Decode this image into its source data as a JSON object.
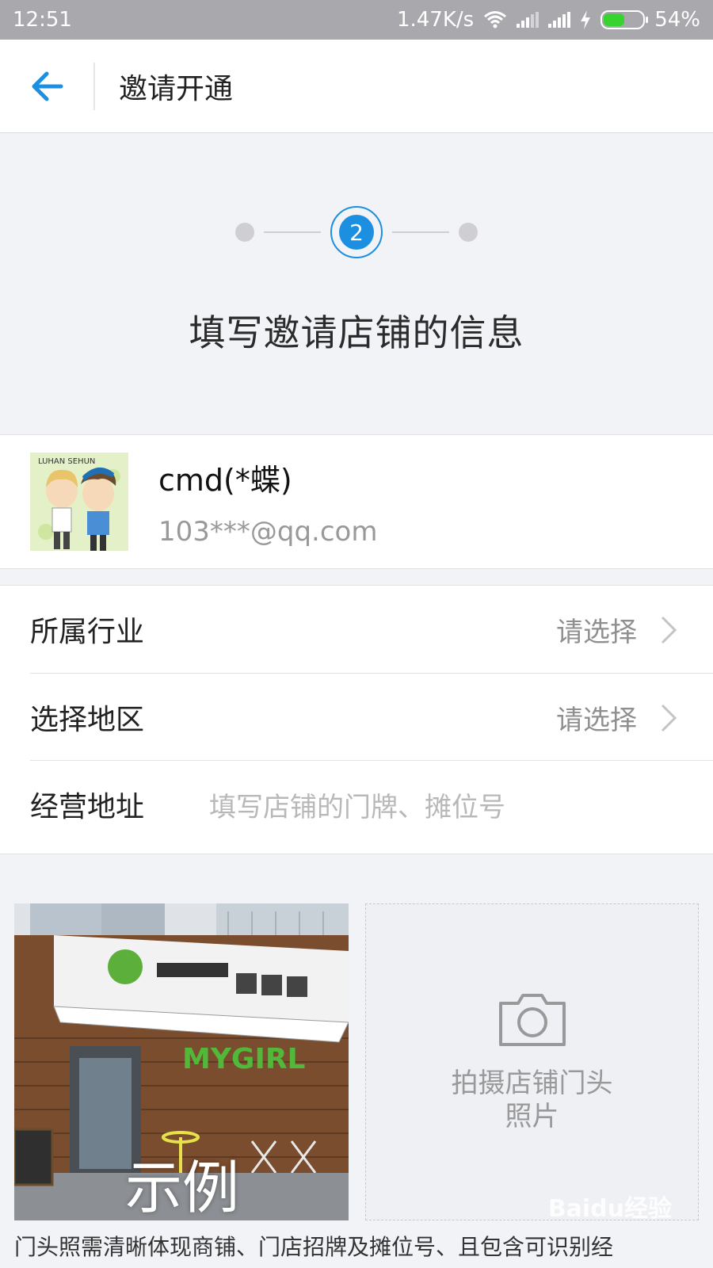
{
  "status_bar": {
    "time": "12:51",
    "network_speed": "1.47K/s",
    "battery_text": "54%",
    "battery_level": 0.54,
    "icons": [
      "wifi-icon",
      "signal-icon",
      "signal-icon",
      "charging-icon",
      "battery-icon"
    ]
  },
  "app_bar": {
    "title": "邀请开通",
    "back_icon": "arrow-left-icon",
    "accent": "#1d8fe0"
  },
  "steps": {
    "current": "2",
    "total": 3
  },
  "heading": "填写邀请店铺的信息",
  "user": {
    "name": "cmd(*蝶)",
    "email": "103***@qq.com"
  },
  "form": {
    "industry_label": "所属行业",
    "industry_value": "请选择",
    "region_label": "选择地区",
    "region_value": "请选择",
    "address_label": "经营地址",
    "address_placeholder": "填写店铺的门牌、摊位号"
  },
  "photos": {
    "example_label": "示例",
    "store_sign_text": "MYGIRL",
    "upload_label": "拍摄店铺门头照片"
  },
  "note": "门头照需清晰体现商铺、门店招牌及摊位号、且包含可识别经",
  "watermark": "Baidu经验"
}
